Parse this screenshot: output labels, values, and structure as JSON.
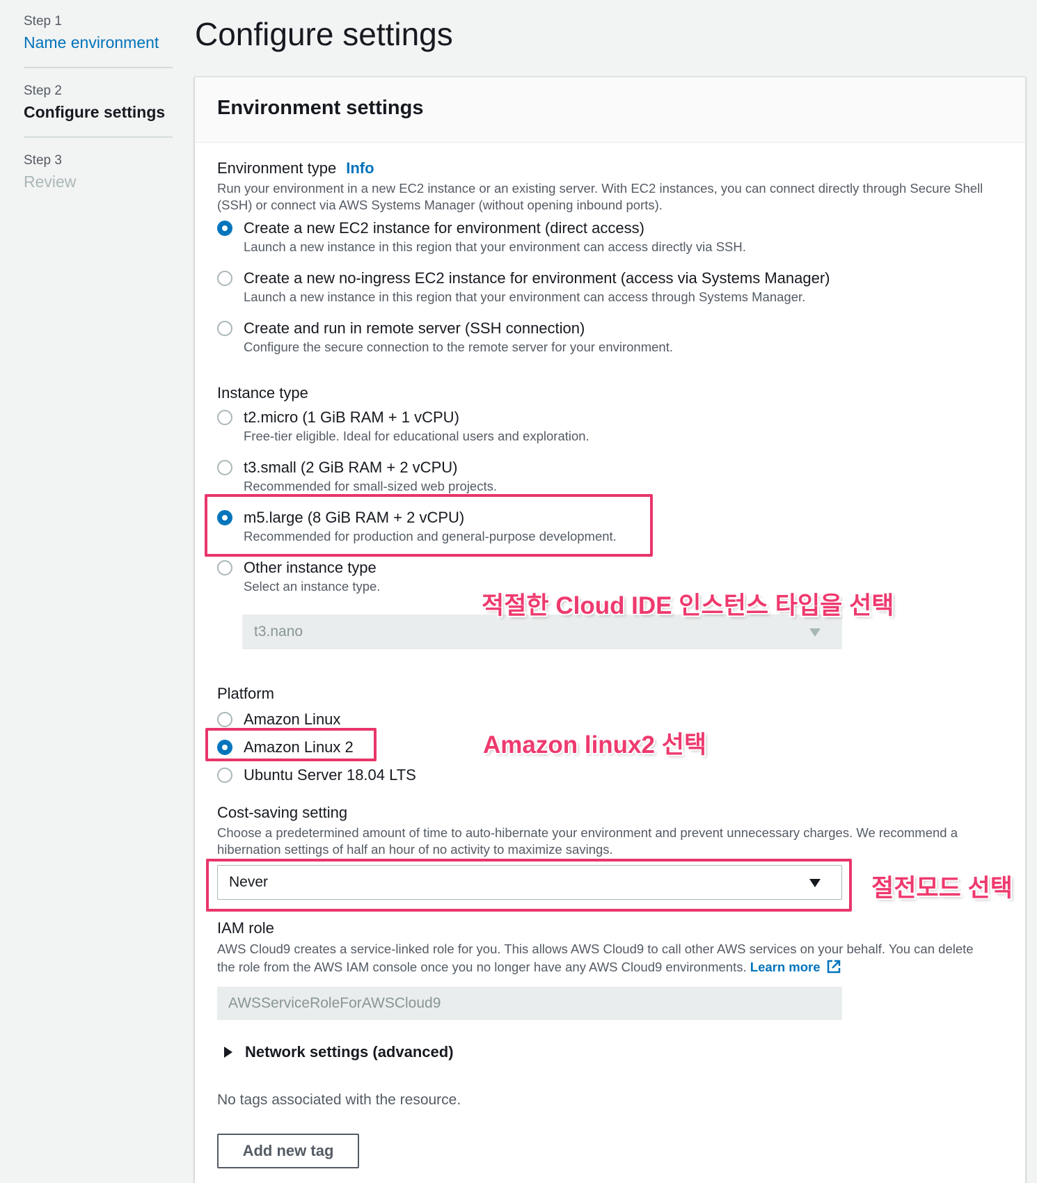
{
  "steps": [
    {
      "num": "Step 1",
      "title": "Name environment"
    },
    {
      "num": "Step 2",
      "title": "Configure settings"
    },
    {
      "num": "Step 3",
      "title": "Review"
    }
  ],
  "page_title": "Configure settings",
  "panel": {
    "title": "Environment settings",
    "environment_type": {
      "label": "Environment type",
      "info": "Info",
      "description": "Run your environment in a new EC2 instance or an existing server. With EC2 instances, you can connect directly through Secure Shell (SSH) or connect via AWS Systems Manager (without opening inbound ports).",
      "options": [
        {
          "label": "Create a new EC2 instance for environment (direct access)",
          "desc": "Launch a new instance in this region that your environment can access directly via SSH.",
          "checked": true
        },
        {
          "label": "Create a new no-ingress EC2 instance for environment (access via Systems Manager)",
          "desc": "Launch a new instance in this region that your environment can access through Systems Manager.",
          "checked": false
        },
        {
          "label": "Create and run in remote server (SSH connection)",
          "desc": "Configure the secure connection to the remote server for your environment.",
          "checked": false
        }
      ]
    },
    "instance_type": {
      "label": "Instance type",
      "options": [
        {
          "label": "t2.micro (1 GiB RAM + 1 vCPU)",
          "desc": "Free-tier eligible. Ideal for educational users and exploration.",
          "checked": false
        },
        {
          "label": "t3.small (2 GiB RAM + 2 vCPU)",
          "desc": "Recommended for small-sized web projects.",
          "checked": false
        },
        {
          "label": "m5.large (8 GiB RAM + 2 vCPU)",
          "desc": "Recommended for production and general-purpose development.",
          "checked": true
        },
        {
          "label": "Other instance type",
          "desc": "Select an instance type.",
          "checked": false
        }
      ],
      "other_select_value": "t3.nano"
    },
    "platform": {
      "label": "Platform",
      "options": [
        {
          "label": "Amazon Linux",
          "checked": false
        },
        {
          "label": "Amazon Linux 2",
          "checked": true
        },
        {
          "label": "Ubuntu Server 18.04 LTS",
          "checked": false
        }
      ]
    },
    "cost_saving": {
      "label": "Cost-saving setting",
      "description": "Choose a predetermined amount of time to auto-hibernate your environment and prevent unnecessary charges. We recommend a hibernation settings of half an hour of no activity to maximize savings.",
      "value": "Never"
    },
    "iam_role": {
      "label": "IAM role",
      "description": "AWS Cloud9 creates a service-linked role for you. This allows AWS Cloud9 to call other AWS services on your behalf. You can delete the role from the AWS IAM console once you no longer have any AWS Cloud9 environments.",
      "learn_more": "Learn more",
      "value": "AWSServiceRoleForAWSCloud9"
    },
    "network_settings": "Network settings (advanced)",
    "tags_empty": "No tags associated with the resource.",
    "add_tag": "Add new tag"
  },
  "annotations": {
    "instance_note": "적절한 Cloud IDE 인스턴스 타입을 선택",
    "platform_note": "Amazon linux2 선택",
    "cost_note": "절전모드 선택",
    "color": "#e8366a"
  },
  "colors": {
    "link": "#0073bb",
    "background": "#f2f3f3",
    "radio_checked": "#0073bb"
  }
}
